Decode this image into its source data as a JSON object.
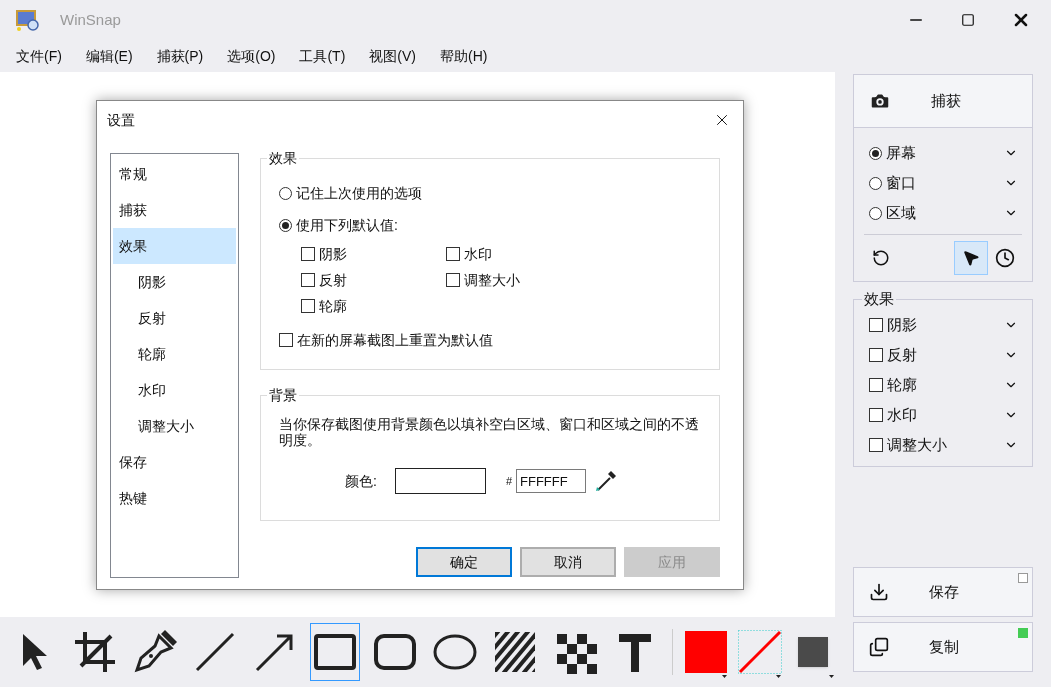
{
  "window": {
    "title": "WinSnap"
  },
  "menu": [
    "文件(F)",
    "编辑(E)",
    "捕获(P)",
    "选项(O)",
    "工具(T)",
    "视图(V)",
    "帮助(H)"
  ],
  "dialog": {
    "title": "设置",
    "nav": [
      {
        "label": "常规",
        "selected": false
      },
      {
        "label": "捕获",
        "selected": false
      },
      {
        "label": "效果",
        "selected": true,
        "children": [
          {
            "label": "阴影",
            "selected": false
          },
          {
            "label": "反射",
            "selected": false
          },
          {
            "label": "轮廓",
            "selected": false
          },
          {
            "label": "水印",
            "selected": false
          },
          {
            "label": "调整大小",
            "selected": false
          }
        ]
      },
      {
        "label": "保存",
        "selected": false
      },
      {
        "label": "热键",
        "selected": false
      }
    ],
    "effects": {
      "title": "效果",
      "options": [
        {
          "label": "记住上次使用的选项",
          "selected": false
        },
        {
          "label": "使用下列默认值:",
          "selected": true
        }
      ],
      "checkboxes": [
        {
          "label": "阴影",
          "checked": false
        },
        {
          "label": "水印",
          "checked": false
        },
        {
          "label": "反射",
          "checked": false
        },
        {
          "label": "调整大小",
          "checked": false
        },
        {
          "label": "轮廓",
          "checked": false
        }
      ],
      "reset": {
        "label": "在新的屏幕截图上重置为默认值",
        "checked": false
      }
    },
    "background": {
      "title": "背景",
      "description": "当你保存截图使用背景颜色以填补空白区域、窗口和区域之间的不透明度。",
      "color_label": "颜色:",
      "hash": "#",
      "hex": "FFFFFF",
      "color": "#ffffff"
    },
    "buttons": [
      {
        "label": "确定",
        "default": true,
        "disabled": false
      },
      {
        "label": "取消",
        "default": false,
        "disabled": false
      },
      {
        "label": "应用",
        "default": false,
        "disabled": true
      }
    ]
  },
  "panel": {
    "capture": "捕获",
    "modes": [
      {
        "label": "屏幕",
        "selected": true
      },
      {
        "label": "窗口",
        "selected": false
      },
      {
        "label": "区域",
        "selected": false
      }
    ],
    "tools": [
      {
        "kind": "undo",
        "selected": false
      },
      {
        "kind": "cursor",
        "selected": true
      },
      {
        "kind": "timer",
        "selected": false
      }
    ],
    "effects_title": "效果",
    "effects": [
      {
        "label": "阴影",
        "checked": false
      },
      {
        "label": "反射",
        "checked": false
      },
      {
        "label": "轮廓",
        "checked": false
      },
      {
        "label": "水印",
        "checked": false
      },
      {
        "label": "调整大小",
        "checked": false
      }
    ],
    "actions": [
      {
        "kind": "save",
        "label": "保存",
        "on": false
      },
      {
        "kind": "copy",
        "label": "复制",
        "on": true
      }
    ]
  },
  "toolbar": {
    "tools": [
      {
        "kind": "pointer",
        "selected": false
      },
      {
        "kind": "crop",
        "selected": false
      },
      {
        "kind": "pen",
        "selected": false
      },
      {
        "kind": "line",
        "selected": false
      },
      {
        "kind": "arrow",
        "selected": false
      },
      {
        "kind": "rectangle",
        "selected": true
      },
      {
        "kind": "rounded",
        "selected": false
      },
      {
        "kind": "ellipse",
        "selected": false
      },
      {
        "kind": "hatch",
        "selected": false
      },
      {
        "kind": "pixelate",
        "selected": false
      },
      {
        "kind": "text",
        "selected": false
      }
    ],
    "colors": [
      {
        "kind": "fill",
        "color": "#ff0000"
      },
      {
        "kind": "line",
        "color": "#ff0000"
      },
      {
        "kind": "shadow",
        "color": "#4a4a4a"
      }
    ]
  }
}
